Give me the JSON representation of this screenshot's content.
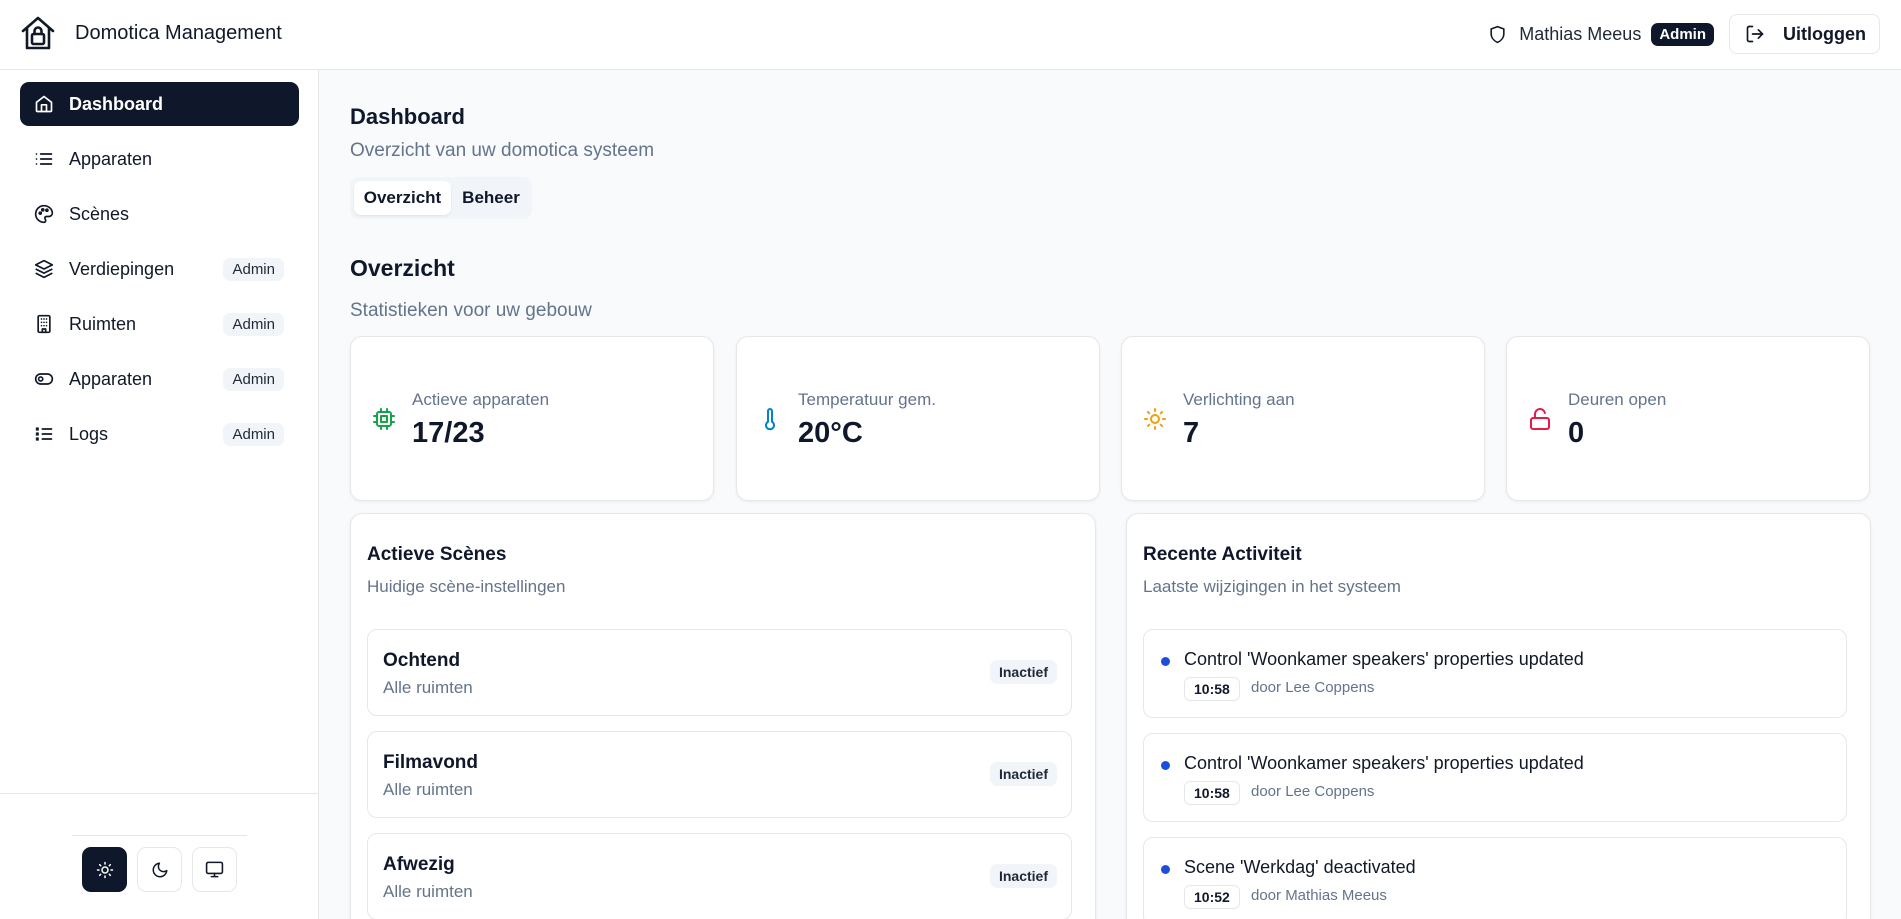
{
  "app": {
    "title": "Domotica Management",
    "icon": "home-lock-icon"
  },
  "header": {
    "user_name": "Mathias Meeus",
    "role_badge": "Admin",
    "logout_label": "Uitloggen"
  },
  "sidebar": {
    "items": [
      {
        "label": "Dashboard",
        "icon": "home-icon",
        "active": true
      },
      {
        "label": "Apparaten",
        "icon": "list-icon"
      },
      {
        "label": "Scènes",
        "icon": "palette-icon"
      },
      {
        "label": "Verdiepingen",
        "icon": "layers-icon",
        "badge": "Admin"
      },
      {
        "label": "Ruimten",
        "icon": "building-icon",
        "badge": "Admin"
      },
      {
        "label": "Apparaten",
        "icon": "toggle-icon",
        "badge": "Admin"
      },
      {
        "label": "Logs",
        "icon": "list-checks-icon",
        "badge": "Admin"
      }
    ],
    "theme_buttons": [
      "sun-icon",
      "moon-icon",
      "monitor-icon"
    ],
    "active_theme": "light"
  },
  "main": {
    "title": "Dashboard",
    "subtitle": "Overzicht van uw domotica systeem",
    "tabs": [
      {
        "label": "Overzicht",
        "active": true
      },
      {
        "label": "Beheer"
      }
    ],
    "section_title": "Overzicht",
    "section_subtitle": "Statistieken voor uw gebouw",
    "stats": [
      {
        "label": "Actieve apparaten",
        "value": "17/23",
        "icon": "cpu-icon",
        "color": "#16a34a"
      },
      {
        "label": "Temperatuur gem.",
        "value": "20°C",
        "icon": "thermometer-icon",
        "color": "#0284c7"
      },
      {
        "label": "Verlichting aan",
        "value": "7",
        "icon": "sun-icon",
        "color": "#f59e0b"
      },
      {
        "label": "Deuren open",
        "value": "0",
        "icon": "unlock-icon",
        "color": "#e11d48"
      }
    ],
    "scenes_panel": {
      "title": "Actieve Scènes",
      "subtitle": "Huidige scène-instellingen",
      "items": [
        {
          "name": "Ochtend",
          "rooms": "Alle ruimten",
          "status": "Inactief"
        },
        {
          "name": "Filmavond",
          "rooms": "Alle ruimten",
          "status": "Inactief"
        },
        {
          "name": "Afwezig",
          "rooms": "Alle ruimten",
          "status": "Inactief"
        }
      ]
    },
    "activity_panel": {
      "title": "Recente Activiteit",
      "subtitle": "Laatste wijzigingen in het systeem",
      "items": [
        {
          "message": "Control 'Woonkamer speakers' properties updated",
          "time": "10:58",
          "user": "door Lee Coppens"
        },
        {
          "message": "Control 'Woonkamer speakers' properties updated",
          "time": "10:58",
          "user": "door Lee Coppens"
        },
        {
          "message": "Scene 'Werkdag' deactivated",
          "time": "10:52",
          "user": "door Mathias Meeus"
        }
      ]
    }
  },
  "colors": {
    "primary": "#0f172a",
    "muted_text": "#64748b",
    "border": "#e5e7eb",
    "activity_dot": "#1d4ed8"
  }
}
